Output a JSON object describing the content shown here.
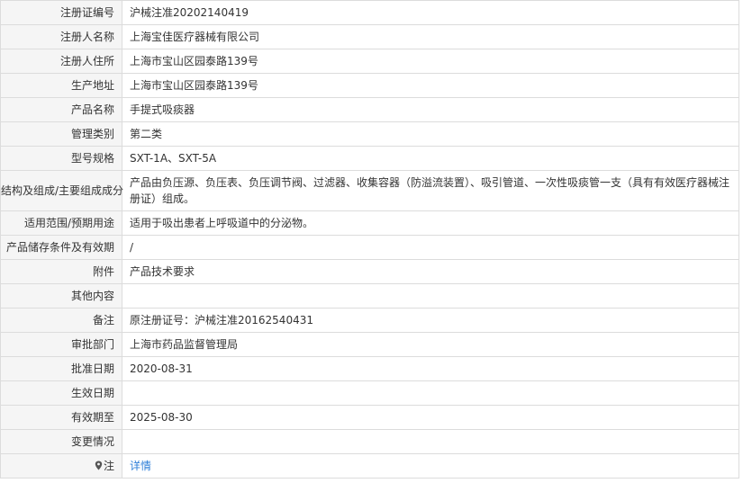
{
  "rows": [
    {
      "label": "注册证编号",
      "value": "沪械注准20202140419"
    },
    {
      "label": "注册人名称",
      "value": "上海宝佳医疗器械有限公司"
    },
    {
      "label": "注册人住所",
      "value": "上海市宝山区园泰路139号"
    },
    {
      "label": "生产地址",
      "value": "上海市宝山区园泰路139号"
    },
    {
      "label": "产品名称",
      "value": "手提式吸痰器"
    },
    {
      "label": "管理类别",
      "value": "第二类"
    },
    {
      "label": "型号规格",
      "value": "SXT-1A、SXT-5A"
    },
    {
      "label": "结构及组成/主要组成成分",
      "value": "产品由负压源、负压表、负压调节阀、过滤器、收集容器（防溢流装置）、吸引管道、一次性吸痰管一支（具有有效医疗器械注册证）组成。"
    },
    {
      "label": "适用范围/预期用途",
      "value": "适用于吸出患者上呼吸道中的分泌物。"
    },
    {
      "label": "产品储存条件及有效期",
      "value": "/"
    },
    {
      "label": "附件",
      "value": "产品技术要求"
    },
    {
      "label": "其他内容",
      "value": ""
    },
    {
      "label": "备注",
      "value": "原注册证号：沪械注准20162540431"
    },
    {
      "label": "审批部门",
      "value": "上海市药品监督管理局"
    },
    {
      "label": "批准日期",
      "value": "2020-08-31"
    },
    {
      "label": "生效日期",
      "value": ""
    },
    {
      "label": "有效期至",
      "value": "2025-08-30"
    },
    {
      "label": "变更情况",
      "value": ""
    }
  ],
  "note_row": {
    "label": "注",
    "icon": "map-pin-icon",
    "link_text": "详情",
    "link_color": "#2f7fd8"
  }
}
